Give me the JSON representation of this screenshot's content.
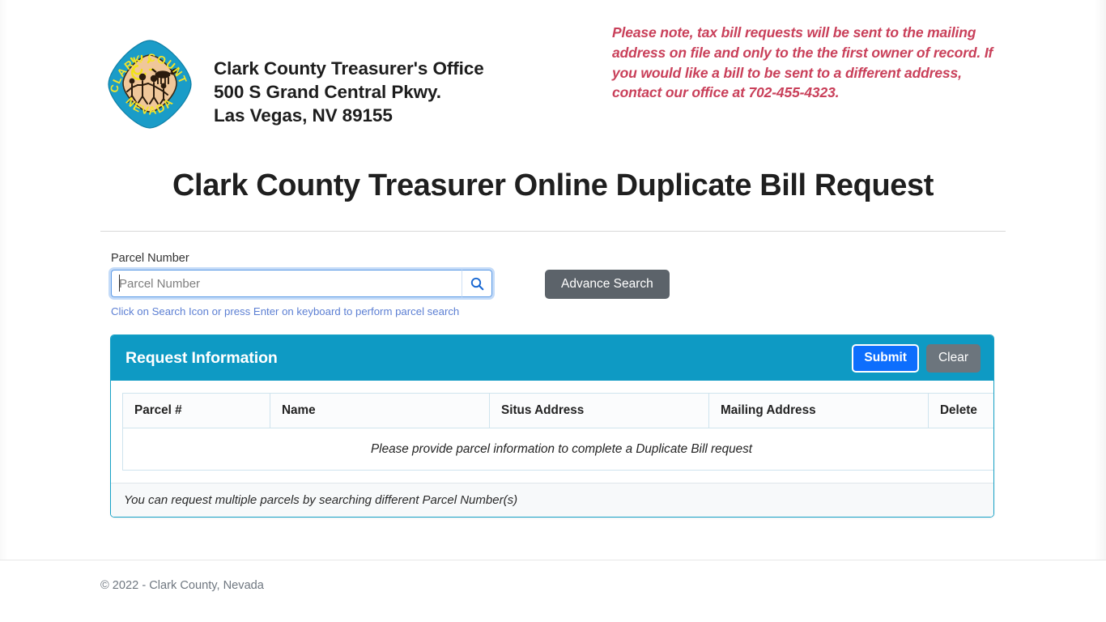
{
  "header": {
    "logo_alt": "Clark County Nevada seal",
    "logo_text_top": "CLARK COUNTY",
    "logo_text_bottom": "NEVADA",
    "office_lines": [
      "Clark County Treasurer's Office",
      "500 S Grand Central Pkwy.",
      "Las Vegas, NV 89155"
    ],
    "notice": "Please note, tax bill requests will be sent to the mailing address on file and only to the the first owner of record. If you would like a bill to be sent to a different address, contact our office at 702-455-4323.",
    "notice_color": "#c9405a"
  },
  "page_title": "Clark County Treasurer Online Duplicate Bill Request",
  "search": {
    "label": "Parcel Number",
    "placeholder": "Parcel Number",
    "value": "",
    "search_icon": "search-icon",
    "advance_button": "Advance Search",
    "hint": "Click on Search Icon or press Enter on keyboard to perform parcel search",
    "hint_color": "#5c7fd3"
  },
  "card": {
    "title": "Request Information",
    "header_color": "#0e9ac4",
    "submit_label": "Submit",
    "submit_color": "#0d6efd",
    "clear_label": "Clear",
    "clear_color": "#6c757d",
    "table": {
      "columns": [
        "Parcel #",
        "Name",
        "Situs Address",
        "Mailing Address",
        "Delete"
      ],
      "rows": [],
      "empty_message": "Please provide parcel information to complete a Duplicate Bill request"
    },
    "footer_note": "You can request multiple parcels by searching different Parcel Number(s)"
  },
  "footer": {
    "copyright": "© 2022 - Clark County, Nevada"
  }
}
